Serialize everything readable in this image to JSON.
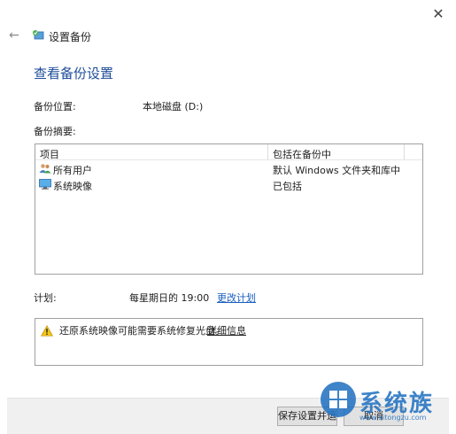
{
  "window": {
    "close_glyph": "✕",
    "back_glyph": "←",
    "title": "设置备份"
  },
  "page": {
    "heading": "查看备份设置"
  },
  "backup_location": {
    "label": "备份位置:",
    "value": "本地磁盘 (D:)"
  },
  "summary": {
    "label": "备份摘要:",
    "columns": [
      "项目",
      "包括在备份中"
    ],
    "rows": [
      {
        "item": "所有用户",
        "icon": "users-icon",
        "included": "默认 Windows 文件夹和库中..."
      },
      {
        "item": "系统映像",
        "icon": "monitor-icon",
        "included": "已包括"
      }
    ]
  },
  "schedule": {
    "label": "计划:",
    "value": "每星期日的 19:00",
    "change_link": "更改计划"
  },
  "warning": {
    "icon": "warning-icon",
    "text": "还原系统映像可能需要系统修复光盘。",
    "link": "详细信息"
  },
  "footer": {
    "save_button": "保存设置并运行备份",
    "cancel_button": "取消"
  },
  "watermark": {
    "text": "系统族",
    "url": "www.xitongzu.com"
  },
  "colors": {
    "heading": "#1f4e99",
    "link": "#1a5fbf",
    "footer_bg": "#f0f0f0"
  }
}
